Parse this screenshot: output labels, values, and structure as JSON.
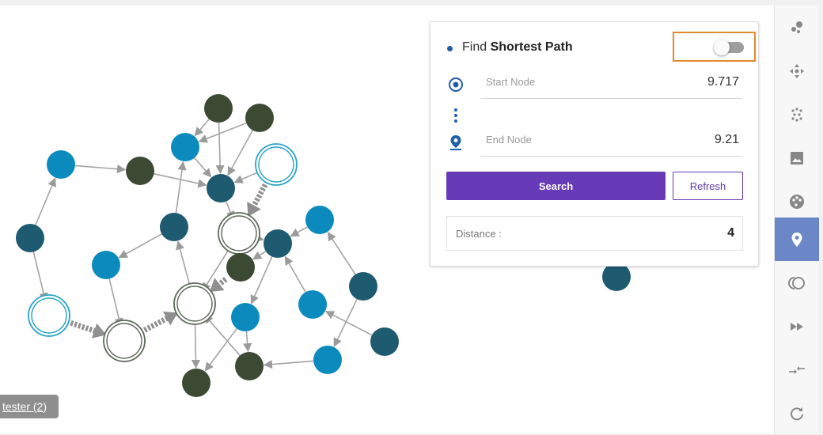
{
  "panel": {
    "title_prefix": "Find",
    "title_bold": "Shortest Path",
    "toggle_on": false,
    "start_label": "Start Node",
    "start_value": "9.717",
    "end_label": "End Node",
    "end_value": "9.21",
    "search_label": "Search",
    "refresh_label": "Refresh",
    "distance_label": "Distance :",
    "distance_value": "4"
  },
  "tester_badge": "tester (2)",
  "sidebar": {
    "items": [
      {
        "icon": "cluster-icon"
      },
      {
        "icon": "move-icon"
      },
      {
        "icon": "dots-grid-icon"
      },
      {
        "icon": "image-icon"
      },
      {
        "icon": "palette-icon"
      },
      {
        "icon": "location-pin-icon",
        "active": true
      },
      {
        "icon": "toggle-rings-icon"
      },
      {
        "icon": "fast-forward-icon"
      },
      {
        "icon": "collapse-arrows-icon"
      },
      {
        "icon": "refresh-icon"
      }
    ]
  },
  "colors": {
    "accent": "#673ab7",
    "active_tab": "#6b87c8",
    "node_blue": "#0b8bbd",
    "node_teal": "#1e5a70",
    "node_olive": "#3c4a34",
    "toggle_outline": "#e08a2a"
  }
}
